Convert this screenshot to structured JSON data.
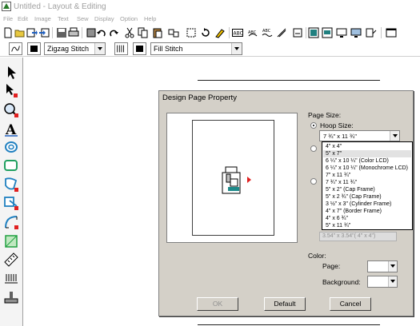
{
  "window": {
    "title": "Untitled - Layout & Editing"
  },
  "menu": [
    "File",
    "Edit",
    "Image",
    "Text",
    "Sew",
    "Display",
    "Option",
    "Help"
  ],
  "stitch_bar": {
    "line_stitch": "Zigzag Stitch",
    "region_stitch": "Fill Stitch"
  },
  "dialog": {
    "title": "Design Page Property",
    "page_size_label": "Page Size:",
    "hoop_size_label": "Hoop Size:",
    "hoop_selected": "7 ¾\" x 11 ¾\"",
    "hoop_options": [
      "4\" x 4\"",
      "5\" x 7\"",
      "6 ¼\" x 10 ¼\" (Color LCD)",
      "6 ¼\" x 10 ¼\" (Monochrome LCD)",
      "7\" x 11 ¾\"",
      "7 ¾\" x 11 ¾\"",
      "5\" x 2\" (Cap Frame)",
      "5\" x 2 ¾\" (Cap Frame)",
      "3 ½\" x 3\" (Cylinder Frame)",
      "4\" x 7\" (Border Frame)",
      "4\" x 6 ¾\"",
      "5\" x 11 ¾\""
    ],
    "hoop_highlighted_index": 1,
    "custom_size_text": "3.54\" x 3.54\"(  4\" x 4\")",
    "color_label": "Color:",
    "page_color_label": "Page:",
    "background_color_label": "Background:",
    "ok_label": "OK",
    "default_label": "Default",
    "cancel_label": "Cancel"
  },
  "colors": {
    "dialog_bg": "#d4d0c8",
    "hoop_teal": "#1e8a8a",
    "arrow_red": "#e02020"
  }
}
